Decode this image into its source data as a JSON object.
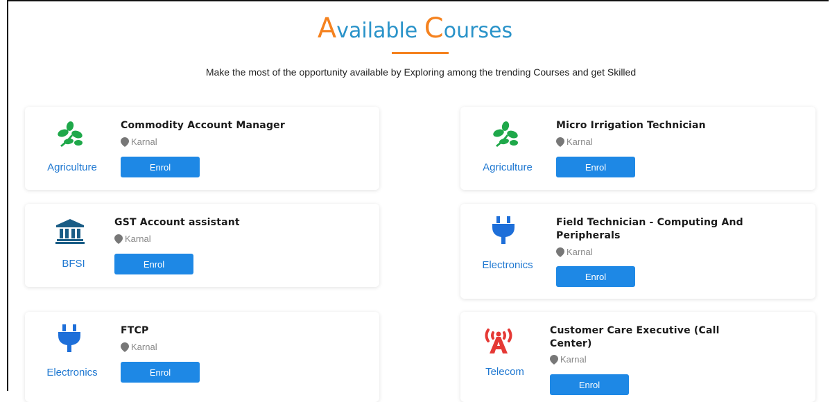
{
  "heading": {
    "first_letter": "A",
    "first_rest": "vailable ",
    "second_letter": "C",
    "second_rest": "ourses"
  },
  "subtitle": "Make the most of the opportunity available by Exploring among the trending Courses and get Skilled",
  "colors": {
    "accent_orange": "#f5821f",
    "title_blue": "#2a93c9",
    "button_blue": "#1e88e5",
    "category_blue": "#1f78d1"
  },
  "courses": [
    {
      "title": "Commodity Account Manager",
      "location": "Karnal",
      "category": "Agriculture",
      "icon": "plant-icon",
      "button": "Enrol"
    },
    {
      "title": "Micro Irrigation Technician",
      "location": "Karnal",
      "category": "Agriculture",
      "icon": "plant-icon",
      "button": "Enrol"
    },
    {
      "title": "GST Account assistant",
      "location": "Karnal",
      "category": "BFSI",
      "icon": "bank-icon",
      "button": "Enrol"
    },
    {
      "title": "Field Technician - Computing And Peripherals",
      "location": "Karnal",
      "category": "Electronics",
      "icon": "plug-icon",
      "button": "Enrol"
    },
    {
      "title": "FTCP",
      "location": "Karnal",
      "category": "Electronics",
      "icon": "plug-icon",
      "button": "Enrol"
    },
    {
      "title": "Customer Care Executive (Call Center)",
      "location": "Karnal",
      "category": "Telecom",
      "icon": "antenna-icon",
      "button": "Enrol"
    }
  ]
}
